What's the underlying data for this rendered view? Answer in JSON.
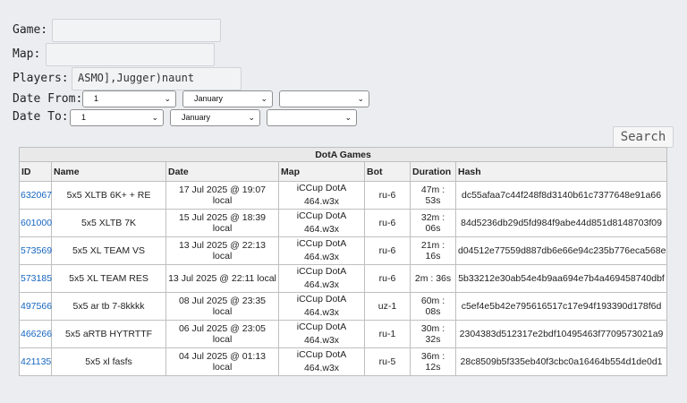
{
  "form": {
    "game_label": "Game:",
    "game_value": "",
    "map_label": "Map:",
    "map_value": "",
    "players_label": "Players:",
    "players_value": "ASMO],Jugger)naunt",
    "date_from_label": "Date From:",
    "date_from": {
      "day": "1",
      "month": "January",
      "year": ""
    },
    "date_to_label": "Date To:",
    "date_to": {
      "day": "1",
      "month": "January",
      "year": ""
    },
    "search_label": "Search"
  },
  "table": {
    "caption": "DotA Games",
    "headers": [
      "ID",
      "Name",
      "Date",
      "Map",
      "Bot",
      "Duration",
      "Hash"
    ],
    "rows": [
      {
        "id": "632067",
        "name": "5x5 XLTB 6K+ + RE",
        "date": "17 Jul 2025 @ 19:07 local",
        "map_line1": "iCCup DotA",
        "map_line2": "464.w3x",
        "bot": "ru-6",
        "duration": "47m : 53s",
        "hash": "dc55afaa7c44f248f8d3140b61c7377648e91a66"
      },
      {
        "id": "601000",
        "name": "5x5 XLTB 7K",
        "date": "15 Jul 2025 @ 18:39 local",
        "map_line1": "iCCup DotA",
        "map_line2": "464.w3x",
        "bot": "ru-6",
        "duration": "32m : 06s",
        "hash": "84d5236db29d5fd984f9abe44d851d8148703f09"
      },
      {
        "id": "573569",
        "name": "5x5 XL TEAM VS",
        "date": "13 Jul 2025 @ 22:13 local",
        "map_line1": "iCCup DotA",
        "map_line2": "464.w3x",
        "bot": "ru-6",
        "duration": "21m : 16s",
        "hash": "d04512e77559d887db6e66e94c235b776eca568e"
      },
      {
        "id": "573185",
        "name": "5x5 XL TEAM RES",
        "date": "13 Jul 2025 @ 22:11 local",
        "map_line1": "iCCup DotA",
        "map_line2": "464.w3x",
        "bot": "ru-6",
        "duration": "2m : 36s",
        "hash": "5b33212e30ab54e4b9aa694e7b4a469458740dbf"
      },
      {
        "id": "497566",
        "name": "5x5 ar tb 7-8kkkk",
        "date": "08 Jul 2025 @ 23:35 local",
        "map_line1": "iCCup DotA",
        "map_line2": "464.w3x",
        "bot": "uz-1",
        "duration": "60m : 08s",
        "hash": "c5ef4e5b42e795616517c17e94f193390d178f6d"
      },
      {
        "id": "466266",
        "name": "5x5 aRTB HYTRTTF",
        "date": "06 Jul 2025 @ 23:05 local",
        "map_line1": "iCCup DotA",
        "map_line2": "464.w3x",
        "bot": "ru-1",
        "duration": "30m : 32s",
        "hash": "2304383d512317e2bdf10495463f7709573021a9"
      },
      {
        "id": "421135",
        "name": "5x5 xl fasfs",
        "date": "04 Jul 2025 @ 01:13 local",
        "map_line1": "iCCup DotA",
        "map_line2": "464.w3x",
        "bot": "ru-5",
        "duration": "36m : 12s",
        "hash": "28c8509b5f335eb40f3cbc0a16464b554d1de0d1"
      }
    ]
  }
}
